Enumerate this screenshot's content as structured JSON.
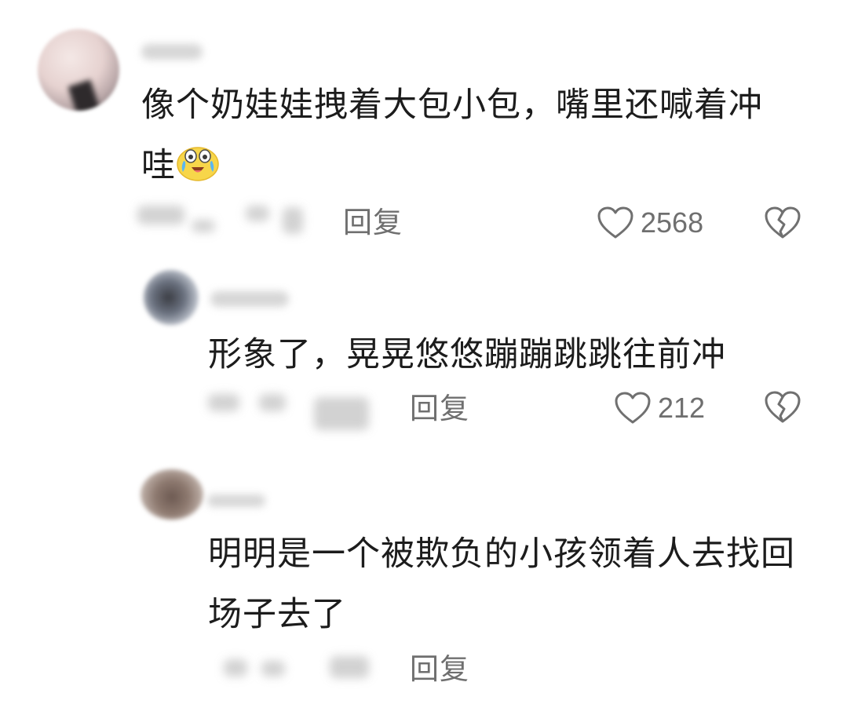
{
  "comments": [
    {
      "text_line1": "像个奶娃娃拽着大包小包，嘴里还喊着冲",
      "text_line2": "哇",
      "emoji": "crying-laughing-emoji",
      "reply_label": "回复",
      "likes": "2568"
    },
    {
      "text_line1": "形象了，晃晃悠悠蹦蹦跳跳往前冲",
      "reply_label": "回复",
      "likes": "212"
    },
    {
      "text_line1": "明明是一个被欺负的小孩领着人去找回",
      "text_line2": "场子去了",
      "reply_label": "回复"
    }
  ],
  "icons": {
    "like": "heart-outline-icon",
    "dislike": "broken-heart-icon"
  },
  "colors": {
    "text": "#1c1c1c",
    "meta": "#6f6f6f",
    "background": "#ffffff"
  }
}
